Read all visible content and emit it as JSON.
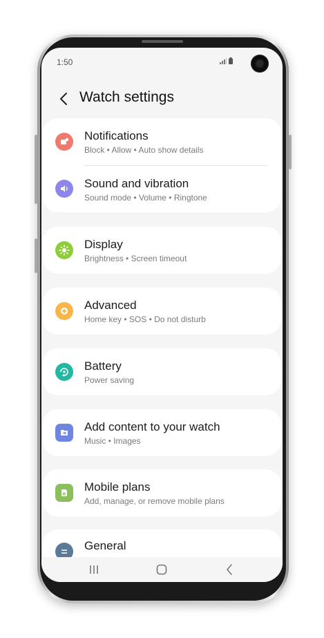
{
  "status_bar": {
    "time": "1:50"
  },
  "header": {
    "title": "Watch settings"
  },
  "settings": [
    {
      "title": "Notifications",
      "subtitle": "Block • Allow • Auto show details",
      "icon": "notifications-icon",
      "color": "#f07a6e"
    },
    {
      "title": "Sound and vibration",
      "subtitle": "Sound mode • Volume • Ringtone",
      "icon": "speaker-icon",
      "color": "#8e86e8"
    },
    {
      "title": "Display",
      "subtitle": "Brightness • Screen timeout",
      "icon": "brightness-icon",
      "color": "#8fcc3c"
    },
    {
      "title": "Advanced",
      "subtitle": "Home key • SOS • Do not disturb",
      "icon": "gear-plus-icon",
      "color": "#f7b54a"
    },
    {
      "title": "Battery",
      "subtitle": "Power saving",
      "icon": "battery-refresh-icon",
      "color": "#24b8a2"
    },
    {
      "title": "Add content to your watch",
      "subtitle": "Music • Images",
      "icon": "import-folder-icon",
      "color": "#6f86e0"
    },
    {
      "title": "Mobile plans",
      "subtitle": "Add, manage, or remove mobile plans",
      "icon": "esim-icon",
      "color": "#8bbf5c"
    },
    {
      "title": "General",
      "subtitle": "",
      "icon": "sliders-icon",
      "color": "#5a7a96"
    }
  ]
}
